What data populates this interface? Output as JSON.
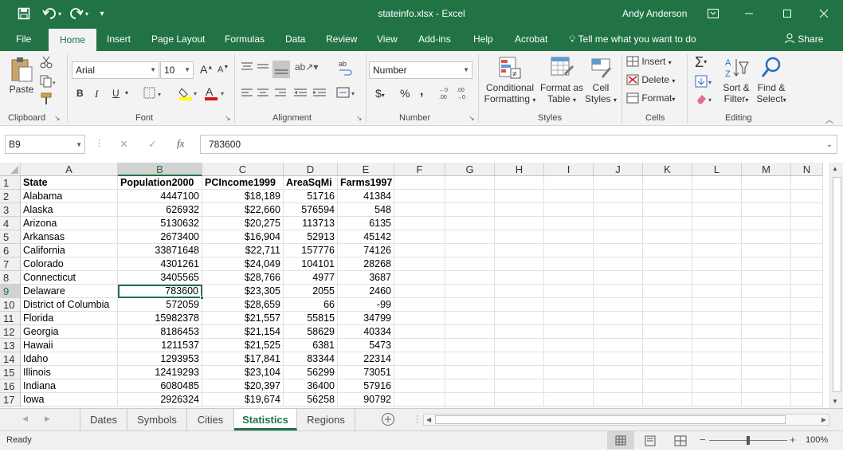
{
  "window": {
    "title": "stateinfo.xlsx - Excel",
    "user": "Andy Anderson"
  },
  "menu": {
    "tabs": [
      "File",
      "Home",
      "Insert",
      "Page Layout",
      "Formulas",
      "Data",
      "Review",
      "View",
      "Add-ins",
      "Help",
      "Acrobat"
    ],
    "active": "Home",
    "tell_me": "Tell me what you want to do",
    "share": "Share"
  },
  "ribbon": {
    "clipboard": {
      "paste": "Paste",
      "label": "Clipboard"
    },
    "font": {
      "name": "Arial",
      "size": "10",
      "bold": "B",
      "italic": "I",
      "underline": "U",
      "label": "Font"
    },
    "alignment": {
      "label": "Alignment"
    },
    "number": {
      "format": "Number",
      "currency": "$",
      "percent": "%",
      "comma": ",",
      "label": "Number"
    },
    "styles": {
      "conditional": [
        "Conditional",
        "Formatting"
      ],
      "format_as": [
        "Format as",
        "Table"
      ],
      "cell_styles": [
        "Cell",
        "Styles"
      ],
      "label": "Styles"
    },
    "cells": {
      "insert": "Insert",
      "delete": "Delete",
      "format": "Format",
      "label": "Cells"
    },
    "editing": {
      "sort": [
        "Sort &",
        "Filter"
      ],
      "find": [
        "Find &",
        "Select"
      ],
      "label": "Editing"
    }
  },
  "formula_bar": {
    "name_box": "B9",
    "cancel": "✕",
    "enter": "✓",
    "fx": "fx",
    "value": "783600"
  },
  "columns": [
    "A",
    "B",
    "C",
    "D",
    "E",
    "F",
    "G",
    "H",
    "I",
    "J",
    "K",
    "L",
    "M",
    "N"
  ],
  "rows": [
    [
      "State",
      "Population2000",
      "PCIncome1999",
      "AreaSqMi",
      "Farms1997"
    ],
    [
      "Alabama",
      "4447100",
      "$18,189",
      "51716",
      "41384"
    ],
    [
      "Alaska",
      "626932",
      "$22,660",
      "576594",
      "548"
    ],
    [
      "Arizona",
      "5130632",
      "$20,275",
      "113713",
      "6135"
    ],
    [
      "Arkansas",
      "2673400",
      "$16,904",
      "52913",
      "45142"
    ],
    [
      "California",
      "33871648",
      "$22,711",
      "157776",
      "74126"
    ],
    [
      "Colorado",
      "4301261",
      "$24,049",
      "104101",
      "28268"
    ],
    [
      "Connecticut",
      "3405565",
      "$28,766",
      "4977",
      "3687"
    ],
    [
      "Delaware",
      "783600",
      "$23,305",
      "2055",
      "2460"
    ],
    [
      "District of Columbia",
      "572059",
      "$28,659",
      "66",
      "-99"
    ],
    [
      "Florida",
      "15982378",
      "$21,557",
      "55815",
      "34799"
    ],
    [
      "Georgia",
      "8186453",
      "$21,154",
      "58629",
      "40334"
    ],
    [
      "Hawaii",
      "1211537",
      "$21,525",
      "6381",
      "5473"
    ],
    [
      "Idaho",
      "1293953",
      "$17,841",
      "83344",
      "22314"
    ],
    [
      "Illinois",
      "12419293",
      "$23,104",
      "56299",
      "73051"
    ],
    [
      "Indiana",
      "6080485",
      "$20,397",
      "36400",
      "57916"
    ],
    [
      "Iowa",
      "2926324",
      "$19,674",
      "56258",
      "90792"
    ]
  ],
  "sheets": {
    "tabs": [
      "Dates",
      "Symbols",
      "Cities",
      "Statistics",
      "Regions"
    ],
    "active": "Statistics"
  },
  "status": {
    "text": "Ready",
    "zoom": "100%"
  }
}
